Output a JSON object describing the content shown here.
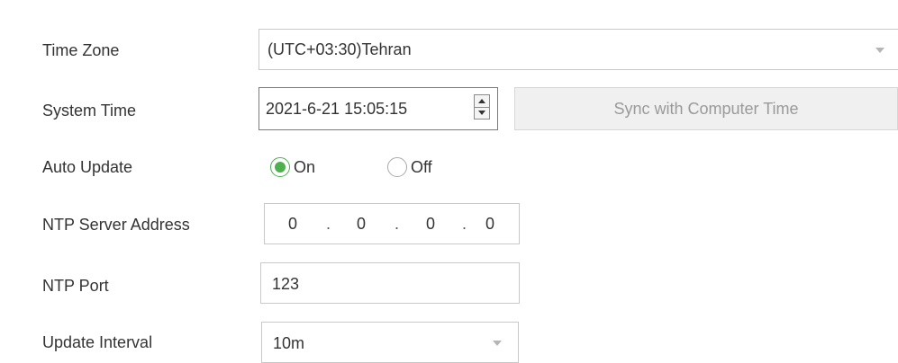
{
  "labels": {
    "time_zone": "Time Zone",
    "system_time": "System Time",
    "auto_update": "Auto Update",
    "ntp_server_address": "NTP Server Address",
    "ntp_port": "NTP Port",
    "update_interval": "Update Interval"
  },
  "time_zone": {
    "selected": "(UTC+03:30)Tehran"
  },
  "system_time": {
    "value": "2021-6-21 15:05:15"
  },
  "sync_button": {
    "label": "Sync with Computer Time"
  },
  "auto_update": {
    "options": [
      {
        "label": "On",
        "checked": true
      },
      {
        "label": "Off",
        "checked": false
      }
    ],
    "accent_color": "#4cb04f"
  },
  "ntp_server_address": {
    "octets": [
      "0",
      "0",
      "0",
      "0"
    ],
    "separator": "."
  },
  "ntp_port": {
    "value": "123"
  },
  "update_interval": {
    "selected": "10m"
  },
  "icons": {
    "dropdown": "chevron-down-icon",
    "spinner_up": "arrow-up-icon",
    "spinner_down": "arrow-down-icon"
  }
}
